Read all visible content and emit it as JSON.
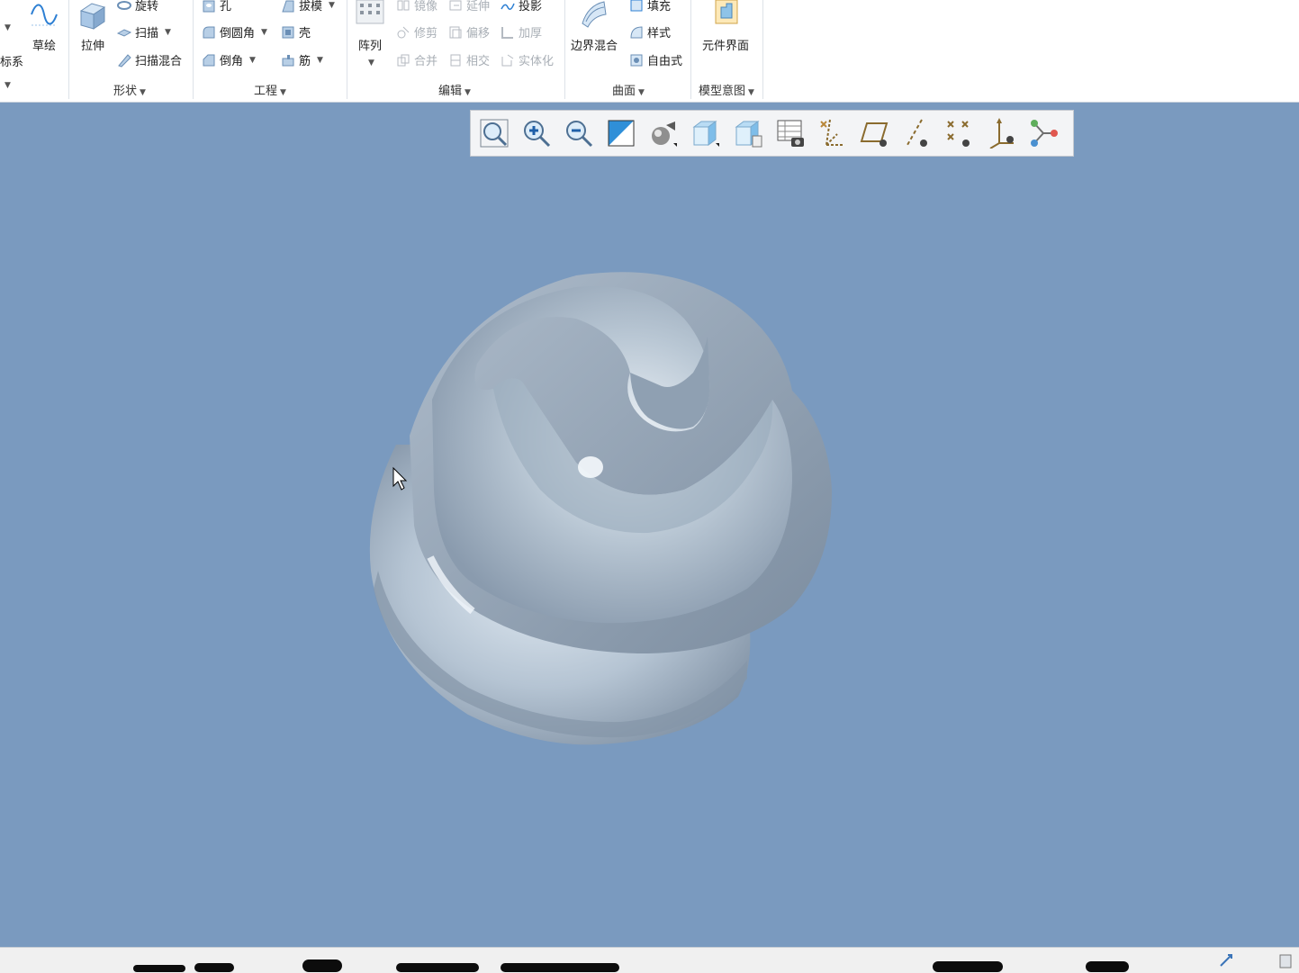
{
  "ribbon": {
    "coord_label": "标系",
    "sketch_label": "草绘",
    "extrude_label": "拉伸",
    "shape": {
      "revolve": "旋转",
      "sweep": "扫描",
      "swept_blend": "扫描混合",
      "group_label": "形状"
    },
    "engineering": {
      "hole": "孔",
      "draft": "拔模",
      "round": "倒圆角",
      "shell": "壳",
      "chamfer": "倒角",
      "rib": "筋",
      "group_label": "工程"
    },
    "editing": {
      "pattern": "阵列",
      "mirror": "镜像",
      "extend": "延伸",
      "project": "投影",
      "trim": "修剪",
      "offset": "偏移",
      "thicken": "加厚",
      "merge": "合并",
      "intersect": "相交",
      "solidify": "实体化",
      "group_label": "编辑"
    },
    "surfaces": {
      "boundary_blend": "边界混合",
      "fill": "填充",
      "style": "样式",
      "freestyle": "自由式",
      "group_label": "曲面"
    },
    "model_intent": {
      "component_interface": "元件界面",
      "group_label": "模型意图"
    }
  },
  "view_toolbar": {
    "buttons": [
      "refit-icon",
      "zoom-in-icon",
      "zoom-out-icon",
      "repaint-icon",
      "display-style-icon",
      "saved-orientations-icon",
      "view-manager-icon",
      "perspective-view-icon",
      "datum-display-filters-icon",
      "plane-display-icon",
      "axis-display-icon",
      "point-display-icon",
      "csys-display-icon",
      "spin-center-icon"
    ]
  },
  "colors": {
    "viewport_bg": "#7a9abf",
    "ribbon_bg": "#ffffff",
    "model_surface": "#b9c6d3"
  }
}
